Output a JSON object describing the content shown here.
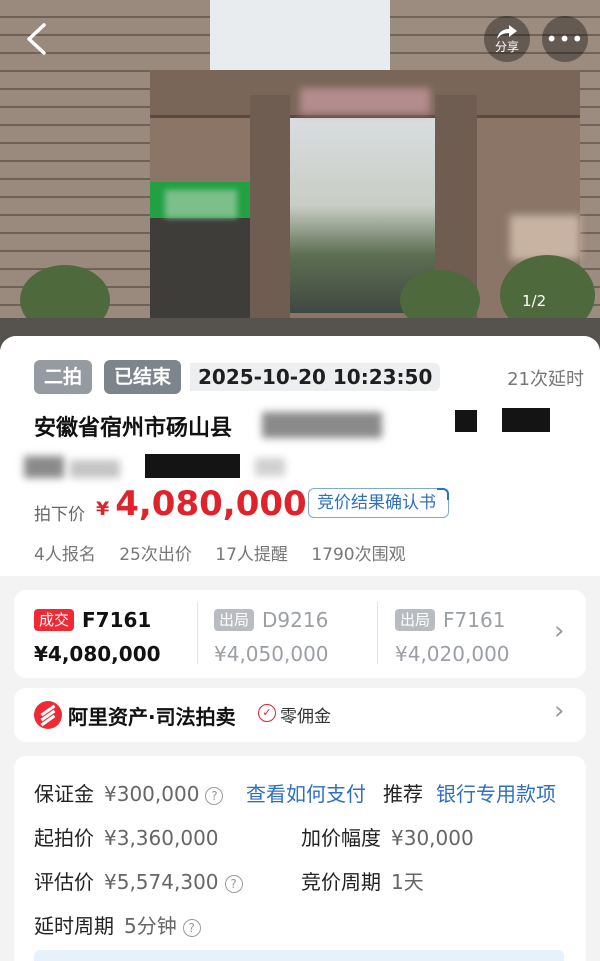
{
  "hero": {
    "share_label": "分享",
    "page_indicator": "1/2",
    "icons": [
      "back-icon",
      "share-icon",
      "more-icon"
    ]
  },
  "auction": {
    "round_tag": "二拍",
    "status_tag": "已结束",
    "end_time": "2025-10-20 10:23:50",
    "delay_count": "21次延时",
    "title_visible": "安徽省宿州市砀山县",
    "final_price_label": "拍下价",
    "currency": "¥",
    "final_price": "4,080,000",
    "confirm_button": "竞价结果确认书",
    "stats": {
      "signups": "4人报名",
      "bids": "25次出价",
      "reminders": "17人提醒",
      "viewers": "1790次围观"
    }
  },
  "bids": [
    {
      "badge": "成交",
      "code": "F7161",
      "amount": "¥4,080,000",
      "status": "win"
    },
    {
      "badge": "出局",
      "code": "D9216",
      "amount": "¥4,050,000",
      "status": "out"
    },
    {
      "badge": "出局",
      "code": "F7161",
      "amount": "¥4,020,000",
      "status": "out"
    }
  ],
  "brand": {
    "name": "阿里资产·司法拍卖",
    "commission_label": "零佣金"
  },
  "details": {
    "deposit_label": "保证金",
    "deposit_value": "¥300,000",
    "how_to_pay": "查看如何支付",
    "recommend_label": "推荐",
    "recommend_value": "银行专用款项",
    "start_price_label": "起拍价",
    "start_price_value": "¥3,360,000",
    "increment_label": "加价幅度",
    "increment_value": "¥30,000",
    "appraisal_label": "评估价",
    "appraisal_value": "¥5,574,300",
    "cycle_label": "竞价周期",
    "cycle_value": "1天",
    "delay_cycle_label": "延时周期",
    "delay_cycle_value": "5分钟"
  },
  "colors": {
    "accent_red": "#e0222b",
    "link_blue": "#2f6fc6",
    "tag_gray": "#8a8f96"
  }
}
